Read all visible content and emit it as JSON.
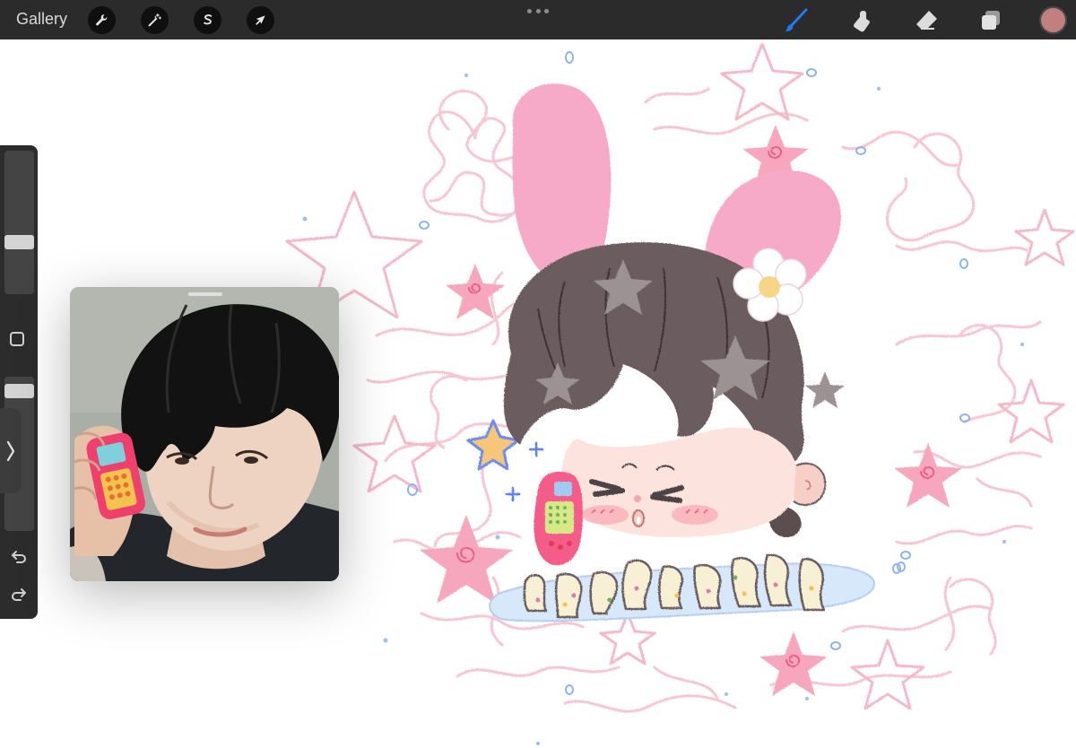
{
  "toolbar": {
    "gallery_label": "Gallery",
    "left_tools": [
      "wrench-icon",
      "magic-wand-icon",
      "selection-icon",
      "transform-arrow-icon"
    ],
    "more_icon": "more-dots-icon",
    "right_tools": [
      "brush-icon",
      "smudge-icon",
      "eraser-icon",
      "layers-icon"
    ],
    "current_color": "#c27f7f"
  },
  "sidebar": {
    "brush_size_level": 0.35,
    "opacity_level": 0.95,
    "icons": [
      "modify-square-icon",
      "undo-icon",
      "redo-icon",
      "chevron-right-icon"
    ]
  },
  "reference_window": {
    "content": "reference-photo"
  },
  "colors": {
    "toolbar_bg": "#2b2b2b",
    "brush_accent": "#1e7cf0",
    "canvas_bg": "#ffffff",
    "pink_ear": "#f7aac7",
    "hair": "#6a5b5e"
  }
}
